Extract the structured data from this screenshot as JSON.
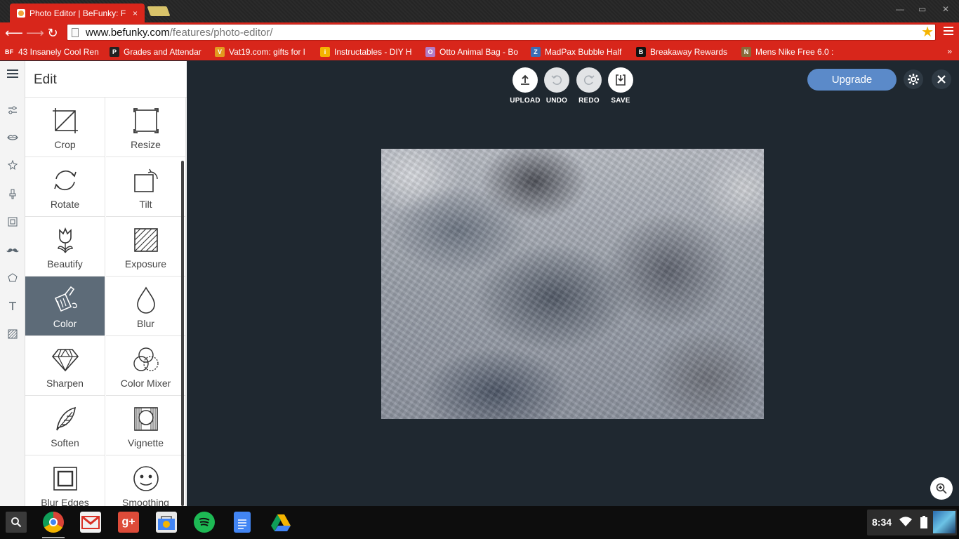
{
  "browser": {
    "tab_title": "Photo Editor | BeFunky: F",
    "tab_close": "×",
    "url_host": "www.befunky.com",
    "url_path": "/features/photo-editor/",
    "bookmarks": [
      {
        "label": "43 Insanely Cool Ren",
        "icon": "BF",
        "color": "#d8261b"
      },
      {
        "label": "Grades and Attendar",
        "icon": "P",
        "color": "#222222"
      },
      {
        "label": "Vat19.com: gifts for l",
        "icon": "V",
        "color": "#e39a1f"
      },
      {
        "label": "Instructables - DIY H",
        "icon": "i",
        "color": "#f4b400"
      },
      {
        "label": "Otto Animal Bag - Bo",
        "icon": "O",
        "color": "#b47cc7"
      },
      {
        "label": "MadPax Bubble Half",
        "icon": "Z",
        "color": "#3b6db5"
      },
      {
        "label": "Breakaway Rewards",
        "icon": "B",
        "color": "#111111"
      },
      {
        "label": "Mens Nike Free 6.0 :",
        "icon": "N",
        "color": "#8a6a3a"
      }
    ],
    "bookmarks_more": "»"
  },
  "panel": {
    "title": "Edit",
    "tools": [
      {
        "label": "Crop",
        "icon": "crop-icon"
      },
      {
        "label": "Resize",
        "icon": "resize-icon"
      },
      {
        "label": "Rotate",
        "icon": "rotate-icon"
      },
      {
        "label": "Tilt",
        "icon": "tilt-icon"
      },
      {
        "label": "Beautify",
        "icon": "beautify-icon"
      },
      {
        "label": "Exposure",
        "icon": "exposure-icon"
      },
      {
        "label": "Color",
        "icon": "color-icon",
        "active": true
      },
      {
        "label": "Blur",
        "icon": "blur-icon"
      },
      {
        "label": "Sharpen",
        "icon": "sharpen-icon"
      },
      {
        "label": "Color Mixer",
        "icon": "color-mixer-icon"
      },
      {
        "label": "Soften",
        "icon": "soften-icon"
      },
      {
        "label": "Vignette",
        "icon": "vignette-icon"
      },
      {
        "label": "Blur Edges",
        "icon": "blur-edges-icon"
      },
      {
        "label": "Smoothing",
        "icon": "smoothing-icon"
      }
    ]
  },
  "topbar": {
    "upload": "UPLOAD",
    "undo": "UNDO",
    "redo": "REDO",
    "save": "SAVE",
    "upgrade": "Upgrade"
  },
  "shelf": {
    "time": "8:34"
  },
  "colors": {
    "chrome_red": "#d8261b",
    "app_bg": "#1f2830",
    "active_tool": "#5d6b78",
    "upgrade_blue": "#5b8ac9"
  }
}
